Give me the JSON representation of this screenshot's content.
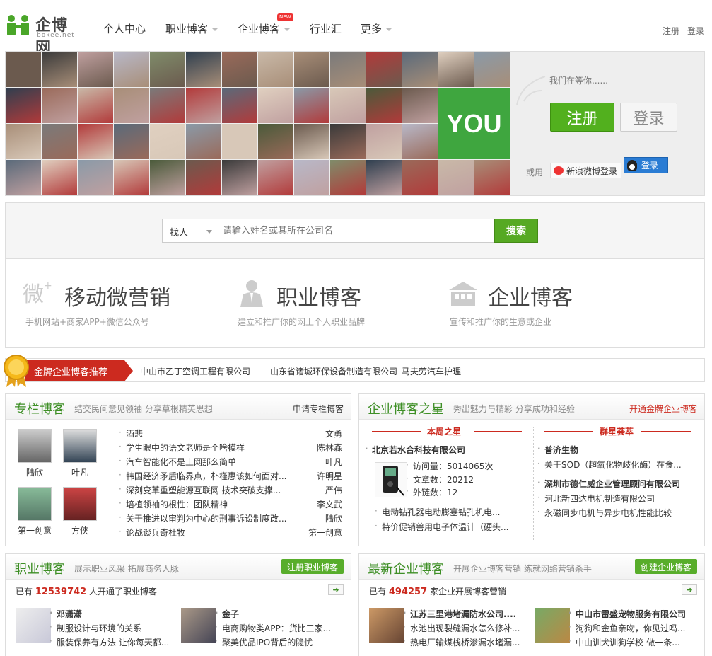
{
  "header": {
    "logo_text": "企博网",
    "logo_sub": "bokee.net",
    "nav": [
      "个人中心",
      "职业博客",
      "企业博客",
      "行业汇",
      "更多"
    ],
    "new_badge": "NEW",
    "register": "注册",
    "login": "登录"
  },
  "hero": {
    "you": "YOU",
    "waiting": "我们在等你......",
    "register_button": "注册",
    "login_button": "登录",
    "or_label": "或用",
    "weibo_login": "新浪微博登录",
    "qq_login": "登录"
  },
  "search": {
    "select_value": "找人",
    "placeholder": "请输入姓名或其所在公司名",
    "button": "搜索"
  },
  "features": [
    {
      "title": "移动微营销",
      "sub": "手机网站+商家APP+微信公众号"
    },
    {
      "title": "职业博客",
      "sub": "建立和推广你的网上个人职业品牌"
    },
    {
      "title": "企业博客",
      "sub": "宣传和推广你的生意或企业"
    }
  ],
  "ribbon": {
    "tag": "金牌企业博客推荐",
    "links": [
      "中山市乙丁空调工程有限公司",
      "山东省诸城环保设备制造有限公司",
      "马夫劳汽车护理"
    ]
  },
  "column_blog": {
    "title": "专栏博客",
    "sub": "结交民间意见领袖 分享草根精英思想",
    "action": "申请专栏博客",
    "people": [
      "陆欣",
      "叶凡",
      "第一创意",
      "方侠"
    ],
    "articles": [
      {
        "title": "酒悲",
        "author": "文勇"
      },
      {
        "title": "学生眼中的语文老师是个啥模样",
        "author": "陈林森"
      },
      {
        "title": "汽车智能化不是上网那么简单",
        "author": "叶凡"
      },
      {
        "title": "韩国经济矛盾临界点，朴槿惠该如何面对...",
        "author": "许明星"
      },
      {
        "title": "深刻变革重塑能源互联网 技术突破支撑...",
        "author": "严伟"
      },
      {
        "title": "培植领袖的根性：团队精神",
        "author": "李文武"
      },
      {
        "title": "关于推进以审判为中心的刑事诉讼制度改...",
        "author": "陆欣"
      },
      {
        "title": "论战谈兵奇杜牧",
        "author": "第一创意"
      }
    ]
  },
  "star_blog": {
    "title": "企业博客之星",
    "sub": "秀出魅力与精彩 分享成功和经验",
    "action": "开通金牌企业博客",
    "week_star_label": "本周之星",
    "week_company": "北京若水合科技有限公司",
    "stats": [
      "访问量：5014065次",
      "文章数：20212",
      "外链数：12"
    ],
    "week_articles": [
      "电动钻孔器电动膨塞钻孔机电...",
      "特价促销兽用电子体温计（硬头..."
    ],
    "group_label": "群星荟萃",
    "group": [
      {
        "company": "普济生物",
        "article": "关于SOD（超氧化物歧化酶）在食..."
      },
      {
        "company": "深圳市德仁威企业管理顾问有限公司",
        "articles": [
          "河北新四达电机制造有限公司",
          "永磁同步电机与异步电机性能比较"
        ]
      }
    ]
  },
  "career_blog": {
    "title": "职业博客",
    "sub": "展示职业风采 拓展商务人脉",
    "action": "注册职业博客",
    "count_prefix": "已有",
    "count": "12539742",
    "count_suffix": "人开通了职业博客",
    "arrow": "➜",
    "items": [
      {
        "name": "邓潇潇",
        "lines": [
          "制服设计与环境的关系",
          "服装保养有方法 让你每天都..."
        ]
      },
      {
        "name": "金子",
        "lines": [
          "电商购物类APP：货比三家...",
          "聚美优品IPO背后的隐忧"
        ]
      }
    ]
  },
  "new_biz_blog": {
    "title": "最新企业博客",
    "sub": "开展企业博客营销 练就网络营销杀手",
    "action": "创建企业博客",
    "count_prefix": "已有",
    "count": "494257",
    "count_suffix": "家企业开展博客营销",
    "arrow": "➜",
    "items": [
      {
        "name": "江苏三里港堵漏防水公司....",
        "lines": [
          "水池出现裂缝漏水怎么修补...",
          "热电厂输煤栈桥渗漏水堵漏..."
        ]
      },
      {
        "name": "中山市雷盛宠物服务有限公司",
        "lines": [
          "狗狗和金鱼亲吻，你见过吗...",
          "中山训犬训狗学校-做一条..."
        ]
      }
    ]
  },
  "colors": {
    "green": "#3e8f26",
    "red": "#cc2a1f",
    "button_green": "#52b01e"
  }
}
